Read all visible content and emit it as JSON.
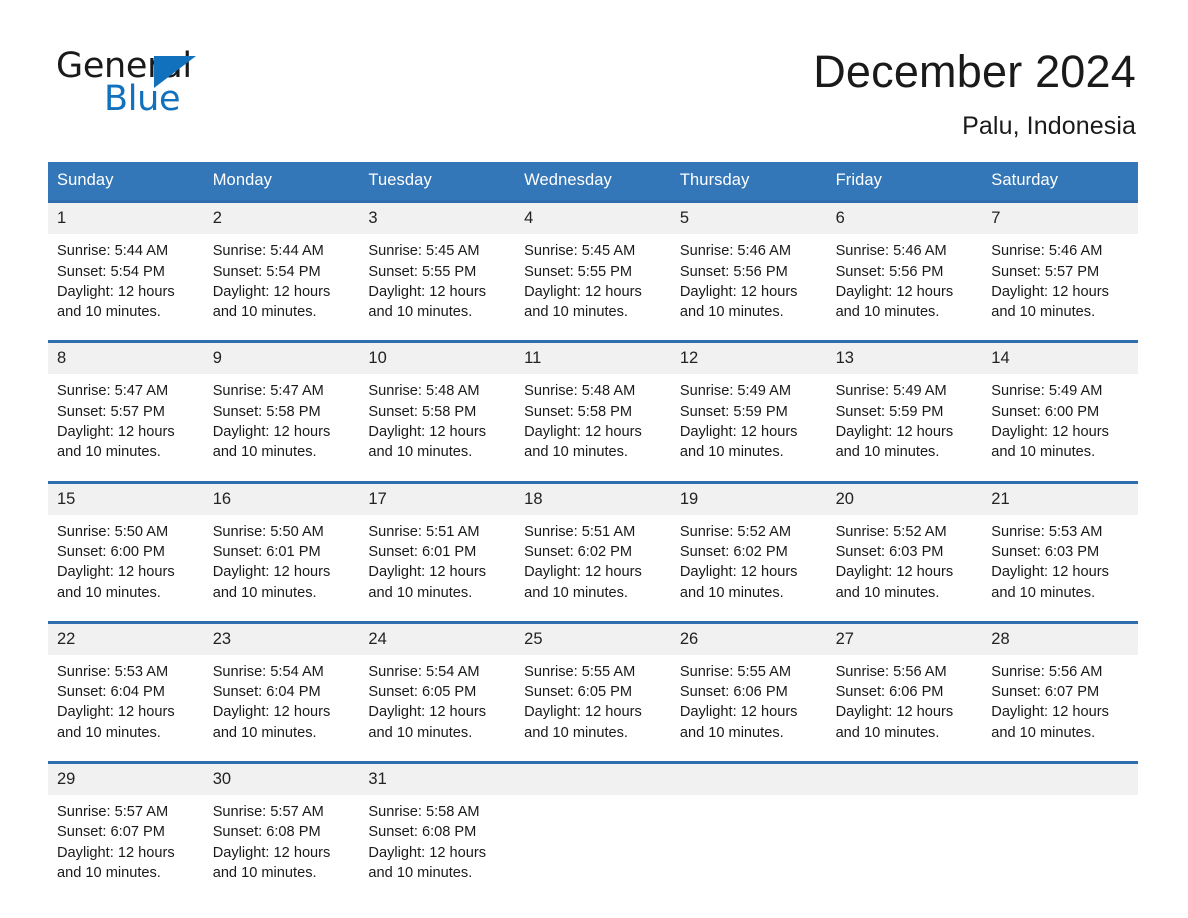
{
  "brand": {
    "name_dark": "General",
    "name_blue": "Blue",
    "triangle_color": "#1271bd"
  },
  "header": {
    "title": "December 2024",
    "location": "Palu, Indonesia",
    "header_bg_color": "#3477b8",
    "row_divider_color": "#2f6eae",
    "daynum_band_color": "#f1f1f1"
  },
  "weekdays": [
    "Sunday",
    "Monday",
    "Tuesday",
    "Wednesday",
    "Thursday",
    "Friday",
    "Saturday"
  ],
  "weeks": [
    {
      "days": [
        {
          "num": "1",
          "sunrise": "Sunrise: 5:44 AM",
          "sunset": "Sunset: 5:54 PM",
          "daylight": "Daylight: 12 hours and 10 minutes."
        },
        {
          "num": "2",
          "sunrise": "Sunrise: 5:44 AM",
          "sunset": "Sunset: 5:54 PM",
          "daylight": "Daylight: 12 hours and 10 minutes."
        },
        {
          "num": "3",
          "sunrise": "Sunrise: 5:45 AM",
          "sunset": "Sunset: 5:55 PM",
          "daylight": "Daylight: 12 hours and 10 minutes."
        },
        {
          "num": "4",
          "sunrise": "Sunrise: 5:45 AM",
          "sunset": "Sunset: 5:55 PM",
          "daylight": "Daylight: 12 hours and 10 minutes."
        },
        {
          "num": "5",
          "sunrise": "Sunrise: 5:46 AM",
          "sunset": "Sunset: 5:56 PM",
          "daylight": "Daylight: 12 hours and 10 minutes."
        },
        {
          "num": "6",
          "sunrise": "Sunrise: 5:46 AM",
          "sunset": "Sunset: 5:56 PM",
          "daylight": "Daylight: 12 hours and 10 minutes."
        },
        {
          "num": "7",
          "sunrise": "Sunrise: 5:46 AM",
          "sunset": "Sunset: 5:57 PM",
          "daylight": "Daylight: 12 hours and 10 minutes."
        }
      ]
    },
    {
      "days": [
        {
          "num": "8",
          "sunrise": "Sunrise: 5:47 AM",
          "sunset": "Sunset: 5:57 PM",
          "daylight": "Daylight: 12 hours and 10 minutes."
        },
        {
          "num": "9",
          "sunrise": "Sunrise: 5:47 AM",
          "sunset": "Sunset: 5:58 PM",
          "daylight": "Daylight: 12 hours and 10 minutes."
        },
        {
          "num": "10",
          "sunrise": "Sunrise: 5:48 AM",
          "sunset": "Sunset: 5:58 PM",
          "daylight": "Daylight: 12 hours and 10 minutes."
        },
        {
          "num": "11",
          "sunrise": "Sunrise: 5:48 AM",
          "sunset": "Sunset: 5:58 PM",
          "daylight": "Daylight: 12 hours and 10 minutes."
        },
        {
          "num": "12",
          "sunrise": "Sunrise: 5:49 AM",
          "sunset": "Sunset: 5:59 PM",
          "daylight": "Daylight: 12 hours and 10 minutes."
        },
        {
          "num": "13",
          "sunrise": "Sunrise: 5:49 AM",
          "sunset": "Sunset: 5:59 PM",
          "daylight": "Daylight: 12 hours and 10 minutes."
        },
        {
          "num": "14",
          "sunrise": "Sunrise: 5:49 AM",
          "sunset": "Sunset: 6:00 PM",
          "daylight": "Daylight: 12 hours and 10 minutes."
        }
      ]
    },
    {
      "days": [
        {
          "num": "15",
          "sunrise": "Sunrise: 5:50 AM",
          "sunset": "Sunset: 6:00 PM",
          "daylight": "Daylight: 12 hours and 10 minutes."
        },
        {
          "num": "16",
          "sunrise": "Sunrise: 5:50 AM",
          "sunset": "Sunset: 6:01 PM",
          "daylight": "Daylight: 12 hours and 10 minutes."
        },
        {
          "num": "17",
          "sunrise": "Sunrise: 5:51 AM",
          "sunset": "Sunset: 6:01 PM",
          "daylight": "Daylight: 12 hours and 10 minutes."
        },
        {
          "num": "18",
          "sunrise": "Sunrise: 5:51 AM",
          "sunset": "Sunset: 6:02 PM",
          "daylight": "Daylight: 12 hours and 10 minutes."
        },
        {
          "num": "19",
          "sunrise": "Sunrise: 5:52 AM",
          "sunset": "Sunset: 6:02 PM",
          "daylight": "Daylight: 12 hours and 10 minutes."
        },
        {
          "num": "20",
          "sunrise": "Sunrise: 5:52 AM",
          "sunset": "Sunset: 6:03 PM",
          "daylight": "Daylight: 12 hours and 10 minutes."
        },
        {
          "num": "21",
          "sunrise": "Sunrise: 5:53 AM",
          "sunset": "Sunset: 6:03 PM",
          "daylight": "Daylight: 12 hours and 10 minutes."
        }
      ]
    },
    {
      "days": [
        {
          "num": "22",
          "sunrise": "Sunrise: 5:53 AM",
          "sunset": "Sunset: 6:04 PM",
          "daylight": "Daylight: 12 hours and 10 minutes."
        },
        {
          "num": "23",
          "sunrise": "Sunrise: 5:54 AM",
          "sunset": "Sunset: 6:04 PM",
          "daylight": "Daylight: 12 hours and 10 minutes."
        },
        {
          "num": "24",
          "sunrise": "Sunrise: 5:54 AM",
          "sunset": "Sunset: 6:05 PM",
          "daylight": "Daylight: 12 hours and 10 minutes."
        },
        {
          "num": "25",
          "sunrise": "Sunrise: 5:55 AM",
          "sunset": "Sunset: 6:05 PM",
          "daylight": "Daylight: 12 hours and 10 minutes."
        },
        {
          "num": "26",
          "sunrise": "Sunrise: 5:55 AM",
          "sunset": "Sunset: 6:06 PM",
          "daylight": "Daylight: 12 hours and 10 minutes."
        },
        {
          "num": "27",
          "sunrise": "Sunrise: 5:56 AM",
          "sunset": "Sunset: 6:06 PM",
          "daylight": "Daylight: 12 hours and 10 minutes."
        },
        {
          "num": "28",
          "sunrise": "Sunrise: 5:56 AM",
          "sunset": "Sunset: 6:07 PM",
          "daylight": "Daylight: 12 hours and 10 minutes."
        }
      ]
    },
    {
      "days": [
        {
          "num": "29",
          "sunrise": "Sunrise: 5:57 AM",
          "sunset": "Sunset: 6:07 PM",
          "daylight": "Daylight: 12 hours and 10 minutes."
        },
        {
          "num": "30",
          "sunrise": "Sunrise: 5:57 AM",
          "sunset": "Sunset: 6:08 PM",
          "daylight": "Daylight: 12 hours and 10 minutes."
        },
        {
          "num": "31",
          "sunrise": "Sunrise: 5:58 AM",
          "sunset": "Sunset: 6:08 PM",
          "daylight": "Daylight: 12 hours and 10 minutes."
        },
        {
          "num": "",
          "sunrise": "",
          "sunset": "",
          "daylight": ""
        },
        {
          "num": "",
          "sunrise": "",
          "sunset": "",
          "daylight": ""
        },
        {
          "num": "",
          "sunrise": "",
          "sunset": "",
          "daylight": ""
        },
        {
          "num": "",
          "sunrise": "",
          "sunset": "",
          "daylight": ""
        }
      ]
    }
  ]
}
